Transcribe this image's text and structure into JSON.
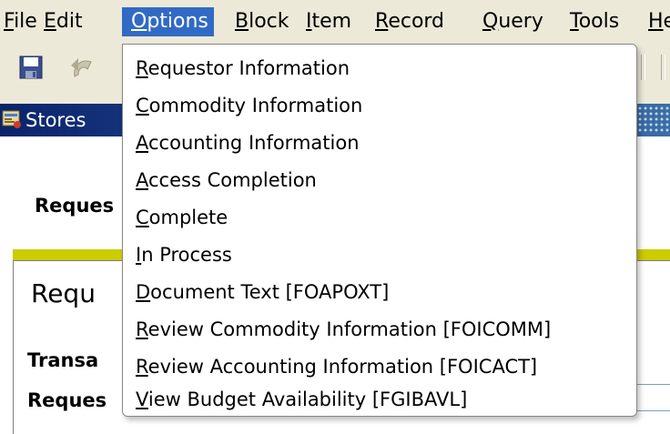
{
  "menubar": {
    "items": [
      {
        "mnemonic": "F",
        "rest": "ile"
      },
      {
        "mnemonic": "E",
        "rest": "dit"
      },
      {
        "mnemonic": "O",
        "rest": "ptions"
      },
      {
        "mnemonic": "B",
        "rest": "lock"
      },
      {
        "mnemonic": "I",
        "rest": "tem"
      },
      {
        "mnemonic": "R",
        "rest": "ecord"
      },
      {
        "mnemonic": "Q",
        "rest": "uery"
      },
      {
        "mnemonic": "T",
        "rest": "ools"
      },
      {
        "mnemonic": "H",
        "rest": "e"
      }
    ],
    "open_menu": "Options"
  },
  "toolbar": {
    "icons": [
      "save-icon",
      "rollback-icon"
    ]
  },
  "window": {
    "title": "Stores"
  },
  "form": {
    "label_requestor_top": "Reques",
    "panel_heading": "Requ",
    "label_transaction": "Transa",
    "label_requestor_bottom": "Reques"
  },
  "options_menu": {
    "items": [
      {
        "mnemonic": "R",
        "rest": "equestor Information"
      },
      {
        "mnemonic": "C",
        "rest": "ommodity Information"
      },
      {
        "mnemonic": "A",
        "rest": "ccounting Information"
      },
      {
        "mnemonic": "A",
        "rest": "ccess Completion"
      },
      {
        "mnemonic": "C",
        "rest": "omplete"
      },
      {
        "mnemonic": "I",
        "rest": "n Process"
      },
      {
        "mnemonic": "D",
        "rest": "ocument Text [FOAPOXT]"
      },
      {
        "mnemonic": "R",
        "rest": "eview Commodity Information [FOICOMM]"
      },
      {
        "mnemonic": "R",
        "rest": "eview Accounting Information [FOICACT]"
      },
      {
        "mnemonic": "V",
        "rest": "iew Budget Availability [FGIBAVL]"
      }
    ]
  },
  "colors": {
    "menu_highlight": "#316ac5",
    "title_bar": "#0a246a",
    "accent_bar": "#cccc00"
  }
}
